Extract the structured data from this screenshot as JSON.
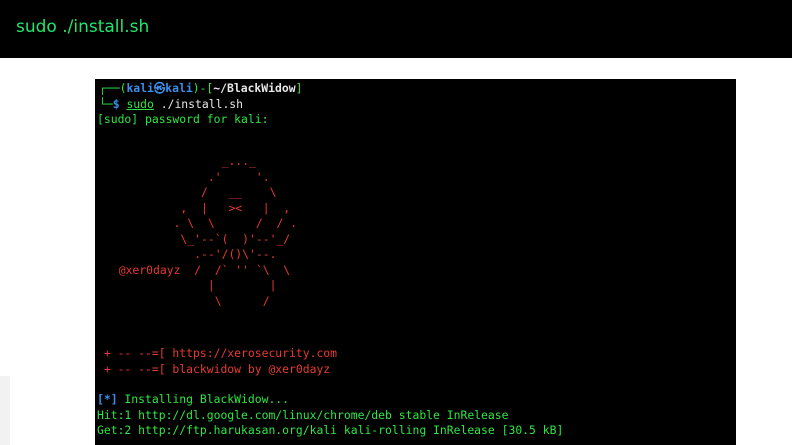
{
  "header": {
    "title": "sudo ./install.sh"
  },
  "terminal": {
    "prompt": {
      "corner_top": "┌──",
      "open_paren": "(",
      "user_host": "kali㉿kali",
      "close_paren": ")",
      "dash": "-",
      "open_bracket": "[",
      "cwd": "~/BlackWidow",
      "close_bracket": "]",
      "corner_bottom": "└─",
      "dollar": "$ ",
      "cmd_sudo": "sudo",
      "cmd_rest": " ./install.sh"
    },
    "sudo_prompt": "[sudo] password for kali: ",
    "spider_art": "                 _..._\n               .'     '.\n              /   __    \\\n           ,  |   ><   |  ,\n          . \\  \\      /  / .\n           \\_'--`(  )'--'_/\n             .--'/()\\'--.\n  @xer0dayz  /  /` '' `\\  \\\n               |        |\n                \\      /",
    "banner_line_1": " + -- --=[ https://xerosecurity.com",
    "banner_line_2": " + -- --=[ blackwidow by @xer0dayz",
    "install_bracket": "[*]",
    "install_text": " Installing BlackWidow...",
    "hit_line": "Hit:1 http://dl.google.com/linux/chrome/deb stable InRelease",
    "get_line": "Get:2 http://ftp.harukasan.org/kali kali-rolling InRelease [30.5 kB]"
  },
  "colors": {
    "header_text": "#21e66a",
    "prompt_blue": "#3b8eea",
    "terminal_green": "#2ee640",
    "art_red": "#e53a2f"
  }
}
